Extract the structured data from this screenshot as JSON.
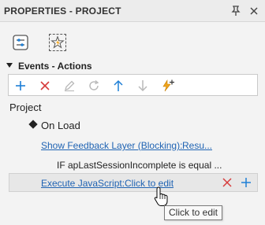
{
  "panel": {
    "title": "PROPERTIES - PROJECT",
    "pin_icon": "pin-icon",
    "close_icon": "close-icon"
  },
  "views": [
    {
      "name": "properties-view",
      "icon": "sliders-icon",
      "selected": false
    },
    {
      "name": "interactions-view",
      "icon": "star-lightning-icon",
      "selected": true
    }
  ],
  "section": {
    "label": "Events - Actions",
    "expanded": true
  },
  "toolbar": {
    "buttons": [
      {
        "name": "add-button",
        "icon": "plus-icon",
        "enabled": true
      },
      {
        "name": "delete-button",
        "icon": "x-icon",
        "enabled": true
      },
      {
        "name": "edit-button",
        "icon": "pencil-icon",
        "enabled": false
      },
      {
        "name": "redo-button",
        "icon": "refresh-icon",
        "enabled": false
      },
      {
        "name": "move-up-button",
        "icon": "arrow-up-icon",
        "enabled": true
      },
      {
        "name": "move-down-button",
        "icon": "arrow-down-icon",
        "enabled": false
      },
      {
        "name": "add-action-button",
        "icon": "lightning-plus-icon",
        "enabled": true
      }
    ]
  },
  "tree": {
    "root": "Project",
    "event": "On Load",
    "action1": {
      "name": "Show Feedback Layer (Blocking):",
      "value": "Resu..."
    },
    "condition": "IF apLastSessionIncomplete is equal ...",
    "action2": {
      "name": "Execute JavaScript:",
      "value": "Click to edit"
    }
  },
  "tooltip": "Click to edit",
  "colors": {
    "link": "#1f63b3",
    "accent_blue": "#1e7fd6",
    "delete_red": "#d63b3b",
    "lightning": "#f0a41c"
  }
}
